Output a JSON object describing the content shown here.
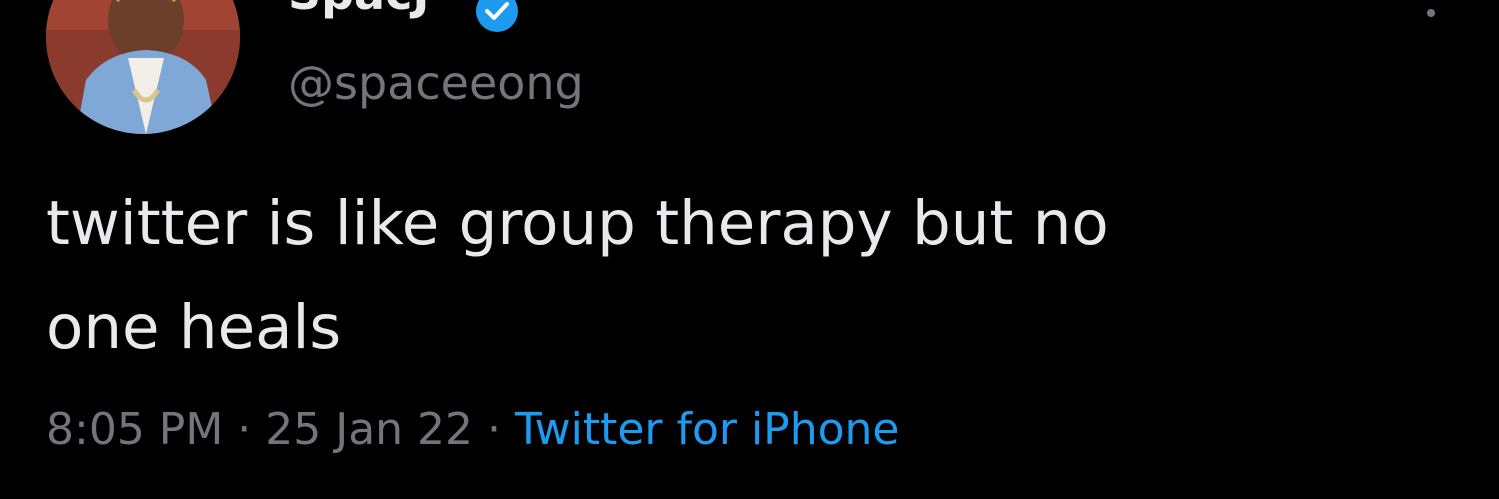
{
  "user": {
    "display_name": "SpacJ",
    "handle": "@spaceeong",
    "verified_icon": "verified-badge-icon",
    "avatar": "profile-photo"
  },
  "tweet": {
    "text": "twitter is like group therapy but no\none heals"
  },
  "meta": {
    "time": "8:05 PM",
    "separator_1": " · ",
    "date": "25 Jan 22",
    "separator_2": " · ",
    "source": "Twitter for iPhone"
  },
  "colors": {
    "background": "#000000",
    "primary_text": "#e7e9ea",
    "secondary_text": "#71767b",
    "accent": "#1d9bf0"
  },
  "icons": {
    "more": "more-options-icon"
  }
}
